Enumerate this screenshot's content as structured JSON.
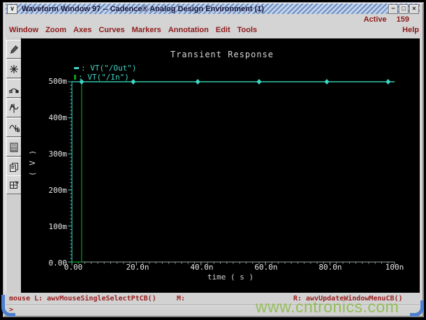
{
  "theme": {
    "menu_red": "#8e1b1b",
    "status_red": "#9a1f1f",
    "titlebar_blue_dark": "#6e8fc3",
    "titlebar_blue_light": "#c3d3ea",
    "chrome_gray": "#d4d4d4",
    "title_text": "#14143c",
    "plot_bg": "#000000",
    "trace_cyan": "#3fd6c6",
    "trace_green": "#00a317",
    "watermark_green": "#8fbc4f",
    "corner_blue": "#4d7fd0"
  },
  "window": {
    "title": "Waveform Window 97 -- Cadence® Analog Design Environment (1)",
    "menu_glyph": "∨",
    "minimize_glyph": "−",
    "maximize_glyph": "□",
    "close_glyph": "×"
  },
  "header": {
    "active_label": "Active",
    "active_count": "159",
    "help": "Help"
  },
  "menubar": {
    "items": [
      "Window",
      "Zoom",
      "Axes",
      "Curves",
      "Markers",
      "Annotation",
      "Edit",
      "Tools"
    ]
  },
  "toolbar": {
    "buttons": [
      "probe",
      "zoom-fit",
      "arc-marker",
      "marker-a",
      "marker-b",
      "calculator",
      "copy-window",
      "split-window"
    ]
  },
  "plot": {
    "title": "Transient Response",
    "legend_colon": ":",
    "y_axis": {
      "label": "( V )",
      "tick_labels_top_down": [
        "500m",
        "400m",
        "300m",
        "200m",
        "100m",
        "0.00"
      ]
    },
    "x_axis": {
      "label": "time ( s )",
      "tick_labels": [
        "0.00",
        "20.0n",
        "40.0n",
        "60.0n",
        "80.0n",
        "100n"
      ]
    }
  },
  "chart_data": {
    "type": "line",
    "title": "Transient Response",
    "xlabel": "time ( s )",
    "ylabel": "( V )",
    "xlim_ns": [
      0,
      100
    ],
    "ylim_v": [
      0,
      0.5
    ],
    "x_major_tick_ns": 20,
    "x_minor_tick_ns": 2,
    "y_major_tick_v": 0.1,
    "y_minor_tick_v": 0.01,
    "x_tick_labels": [
      "0.00",
      "20.0n",
      "40.0n",
      "60.0n",
      "80.0n",
      "100n"
    ],
    "y_tick_labels": [
      "0.00",
      "100m",
      "200m",
      "300m",
      "400m",
      "500m"
    ],
    "grid": false,
    "background": "#000000",
    "axis_colors": {
      "y": "#35d0c2",
      "x": "#8fa398"
    },
    "series": [
      {
        "name": "VT(\"/Out\")",
        "color": "#3fd6c6",
        "points_ns_v": [
          [
            0,
            0.5
          ],
          [
            100,
            0.5
          ]
        ],
        "marker": "diamond",
        "marker_x_ns": [
          3,
          19,
          39,
          58,
          79,
          98
        ],
        "marker_y_v": 0.5
      },
      {
        "name": "VT(\"/In\")",
        "color": "#00a317",
        "points_ns_v": [
          [
            0,
            0
          ],
          [
            3,
            0
          ],
          [
            3,
            0.5
          ],
          [
            100,
            0.5
          ]
        ],
        "marker": "none"
      }
    ]
  },
  "statusbar": {
    "left": "mouse L: awvMouseSingleSelectPtCB()",
    "middle": "M:",
    "right": "R: awvUpdateWindowMenuCB()",
    "prompt": ">"
  },
  "watermark": "www.cntronics.com"
}
